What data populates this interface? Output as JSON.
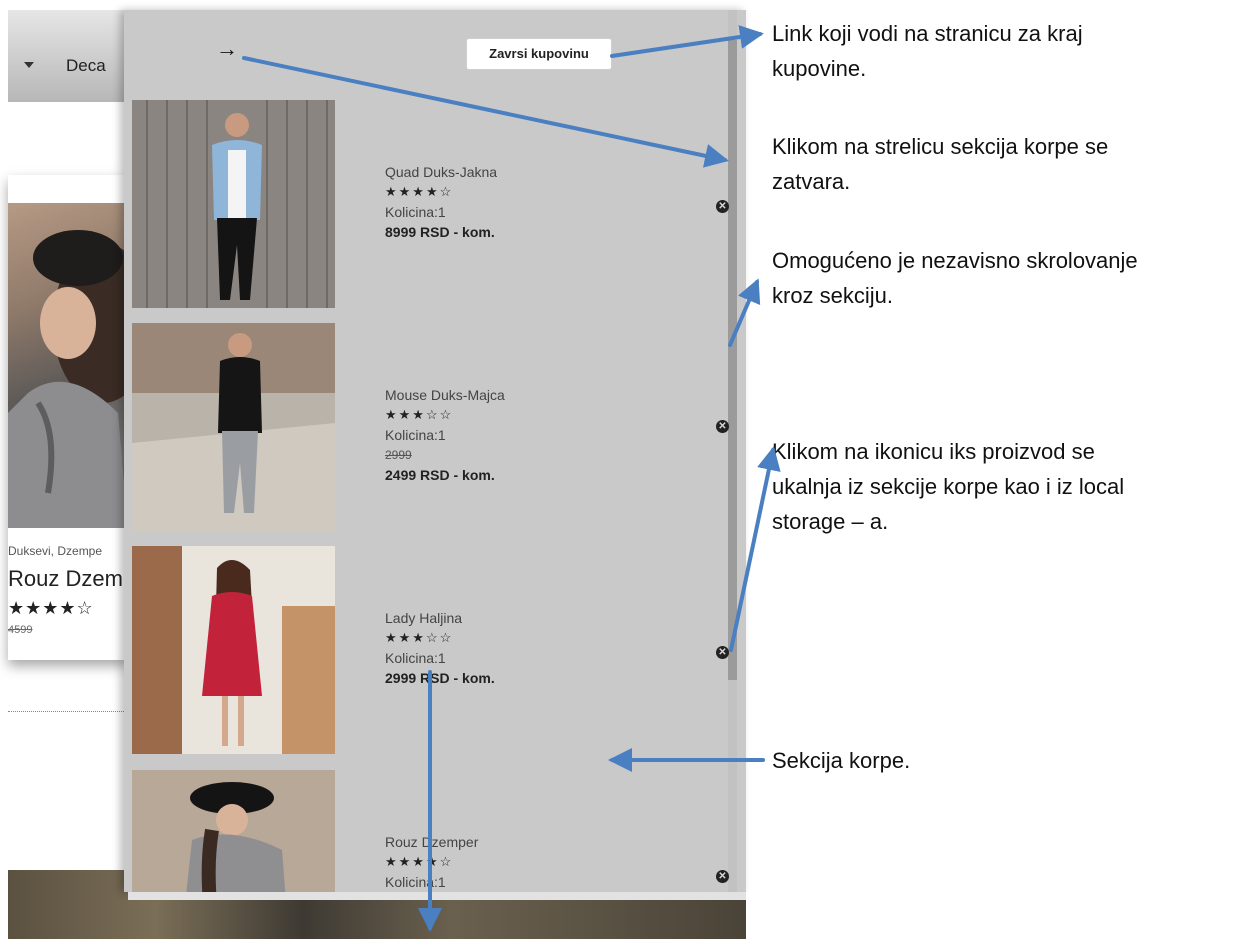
{
  "background_page": {
    "nav_item": "Deca",
    "card": {
      "category": "Duksevi, Dzempe",
      "title": "Rouz Dzem",
      "stars": "★★★★☆",
      "old_price": "4599"
    }
  },
  "cart": {
    "checkout_label": "Zavrsi kupovinu",
    "close_arrow": "→",
    "remove_glyph": "✕",
    "items": [
      {
        "name": "Quad Duks-Jakna",
        "stars": "★★★★☆",
        "quantity": "Kolicina:1",
        "old_price": "",
        "price": "8999 RSD - kom."
      },
      {
        "name": "Mouse Duks-Majca",
        "stars": "★★★☆☆",
        "quantity": "Kolicina:1",
        "old_price": "2999",
        "price": "2499 RSD - kom."
      },
      {
        "name": "Lady Haljina",
        "stars": "★★★☆☆",
        "quantity": "Kolicina:1",
        "old_price": "",
        "price": "2999 RSD - kom."
      },
      {
        "name": "Rouz Dzemper",
        "stars": "★★★★☆",
        "quantity": "Kolicina:1",
        "old_price": "",
        "price": ""
      }
    ]
  },
  "annotations": {
    "checkout_link": [
      "Link koji vodi na stranicu za kraj",
      "kupovine."
    ],
    "close_arrow": [
      "Klikom na strelicu sekcija korpe se",
      "zatvara."
    ],
    "scrolling": [
      "Omogućeno je nezavisno skrolovanje",
      "kroz sekciju."
    ],
    "remove_icon": [
      "Klikom na ikonicu iks proizvod se",
      "ukalnja iz sekcije korpe kao i iz local",
      "storage – a."
    ],
    "cart_section": [
      "Sekcija korpe."
    ]
  },
  "colors": {
    "panel_bg": "#c9c9c9",
    "arrow": "#4a7fc1"
  }
}
